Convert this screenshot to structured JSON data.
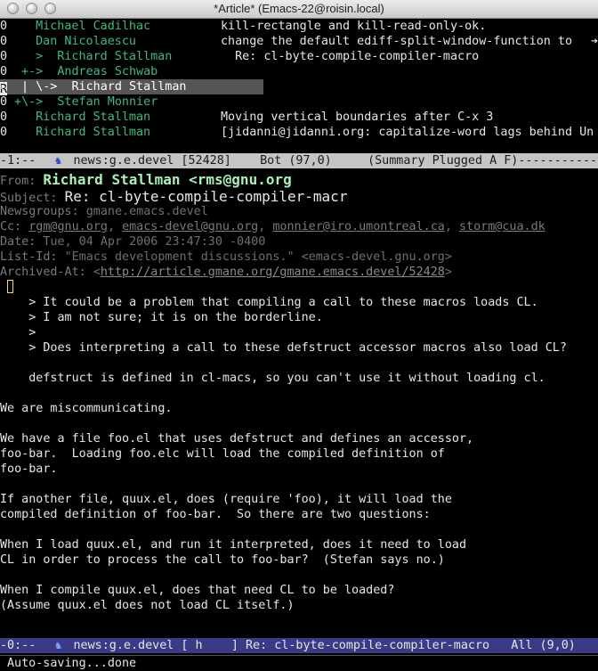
{
  "window": {
    "title": "*Article* (Emacs-22@roisin.local)"
  },
  "summary": {
    "rows": [
      {
        "score": "0",
        "thread": "  Michael Cadilhac",
        "subject": "kill-rectangle and kill-read-only-ok."
      },
      {
        "score": "0",
        "thread": "  Dan Nicolaescu",
        "subject": "change the default ediff-split-window-function to"
      },
      {
        "score": "0",
        "thread": "  >  Richard Stallman",
        "subject": "  Re: cl-byte-compile-compiler-macro"
      },
      {
        "score": "0",
        "thread": " +->  Andreas Schwab",
        "subject": ""
      },
      {
        "score": "R",
        "thread": " | \\->  Richard Stallman",
        "subject": ""
      },
      {
        "score": "0",
        "thread": "+\\->  Stefan Monnier",
        "subject": ""
      },
      {
        "score": "0",
        "thread": "  Richard Stallman",
        "subject": "Moving vertical boundaries after C-x 3"
      },
      {
        "score": "0",
        "thread": "  Richard Stallman",
        "subject": "[jidanni@jidanni.org: capitalize-word lags behind Un"
      }
    ],
    "modeline": {
      "left": "-1:--  ",
      "buffer": " news:g.e.devel [52428]",
      "mid": "    Bot (97,0)     ",
      "right": "(Summary Plugged A F)-----------"
    }
  },
  "article": {
    "from_label": "From:",
    "from_value": "Richard Stallman <rms@gnu.org",
    "subject_label": "Subject:",
    "subject_value": "Re: cl-byte-compile-compiler-macr",
    "newsgroups_label": "Newsgroups:",
    "newsgroups_value": "gmane.emacs.devel",
    "cc_label": "Cc:",
    "cc_list": [
      "rgm@gnu.org",
      "emacs-devel@gnu.org",
      "monnier@iro.umontreal.ca",
      "storm@cua.dk"
    ],
    "date_label": "Date:",
    "date_value": "Tue, 04 Apr 2006 23:47:30 -0400",
    "listid_label": "List-Id:",
    "listid_value": "\"Emacs development discussions.\" <emacs-devel.gnu.org>",
    "archived_label": "Archived-At:",
    "archived_value": "http://article.gmane.org/gmane.emacs.devel/52428",
    "body": [
      "    > It could be a problem that compiling a call to these macros loads CL.",
      "    > I am not sure; it is on the borderline.",
      "    >",
      "    > Does interpreting a call to these defstruct accessor macros also load CL?",
      "",
      "    defstruct is defined in cl-macs, so you can't use it without loading cl.",
      "",
      "We are miscommunicating.",
      "",
      "We have a file foo.el that uses defstruct and defines an accessor,",
      "foo-bar.  Loading foo.elc will load the compiled definition of",
      "foo-bar.",
      "",
      "If another file, quux.el, does (require 'foo), it will load the",
      "compiled definition of foo-bar.  So there are two questions:",
      "",
      "When I load quux.el, and run it interpreted, does it need to load",
      "CL in order to process the call to foo-bar?  (Stefan says no.)",
      "",
      "When I compile quux.el, does that need CL to be loaded?",
      "(Assume quux.el does not load CL itself.)"
    ],
    "modeline": {
      "left": "-0:--  ",
      "buffer": " news:g.e.devel [ h    ]",
      "mid": " Re: cl-byte-compile-compiler-macro",
      "right": "   All (9,0)"
    }
  },
  "echo_area": "Auto-saving...done",
  "icons": {
    "gnu": "gnu-icon",
    "close": "close-icon",
    "minimize": "minimize-icon",
    "zoom": "zoom-icon"
  }
}
